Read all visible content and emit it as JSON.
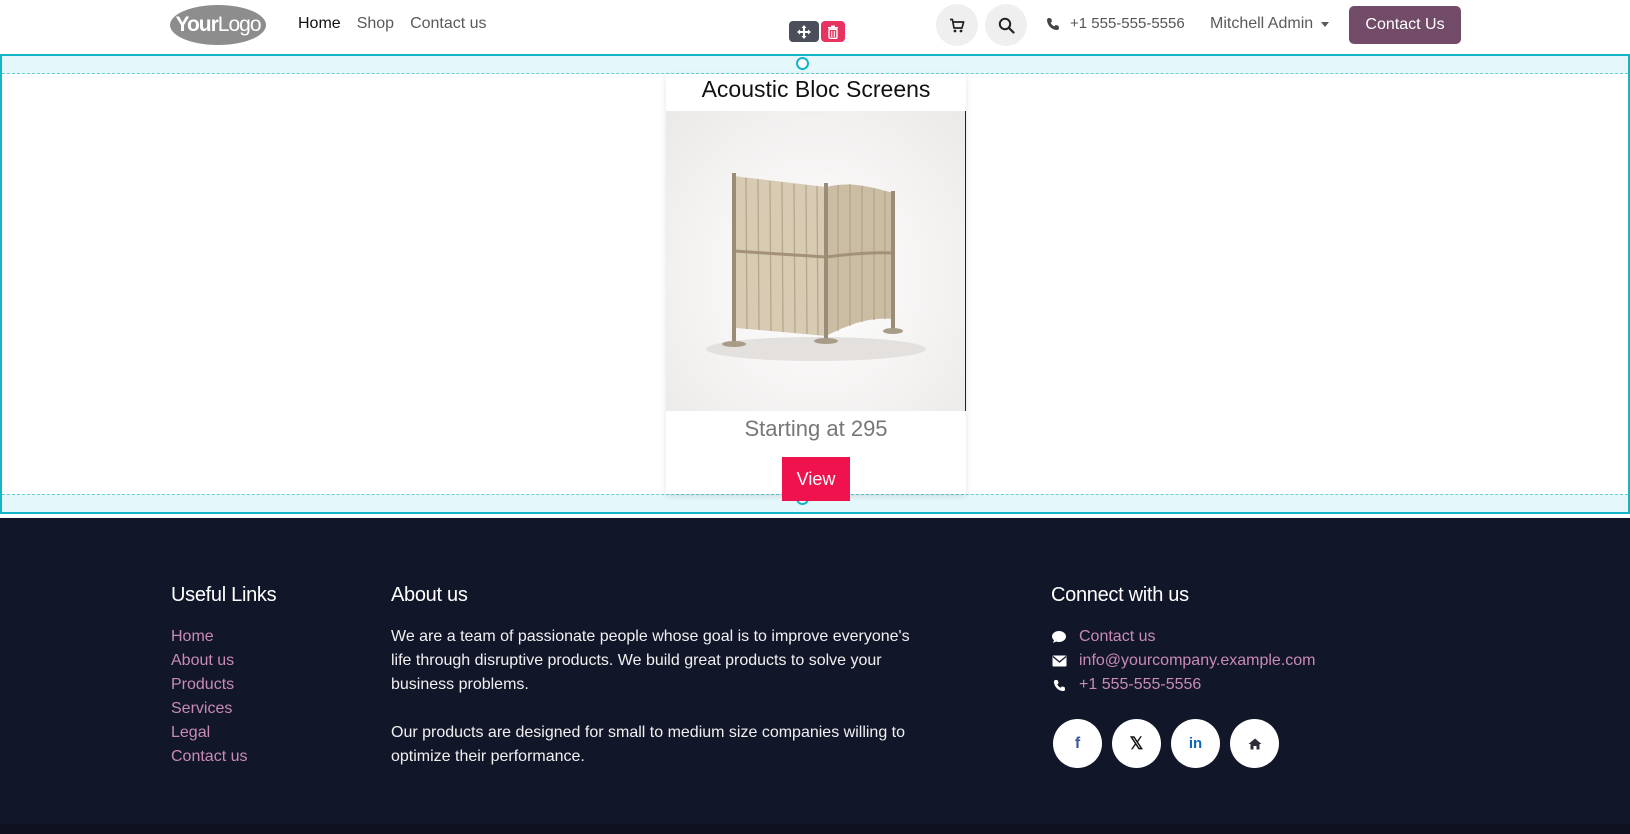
{
  "header": {
    "logo": {
      "bold": "Your",
      "light": "Logo"
    },
    "nav": [
      "Home",
      "Shop",
      "Contact us"
    ],
    "phone": "+1 555-555-5556",
    "user": "Mitchell Admin",
    "cta": "Contact Us"
  },
  "editor": {
    "tools": [
      "move-icon",
      "trash-icon"
    ]
  },
  "product_card": {
    "title": "Acoustic Bloc Screens",
    "price": "Starting at 295",
    "button": "View"
  },
  "footer": {
    "useful_links": {
      "heading": "Useful Links",
      "items": [
        "Home",
        "About us",
        "Products",
        "Services",
        "Legal",
        "Contact us"
      ]
    },
    "about": {
      "heading": "About us",
      "p1": "We are a team of passionate people whose goal is to improve everyone's life through disruptive products. We build great products to solve your business problems.",
      "p2": "Our products are designed for small to medium size companies willing to optimize their performance."
    },
    "connect": {
      "heading": "Connect with us",
      "items": [
        "Contact us",
        "info@yourcompany.example.com",
        "+1 555-555-5556"
      ]
    },
    "social_icons": [
      "facebook-icon",
      "x-twitter-icon",
      "linkedin-icon",
      "home-icon"
    ]
  },
  "colors": {
    "accent": "#714b67",
    "button": "#f0124d",
    "selection": "#14b5c9",
    "footer_bg": "#121629",
    "link": "#c88ab8"
  }
}
